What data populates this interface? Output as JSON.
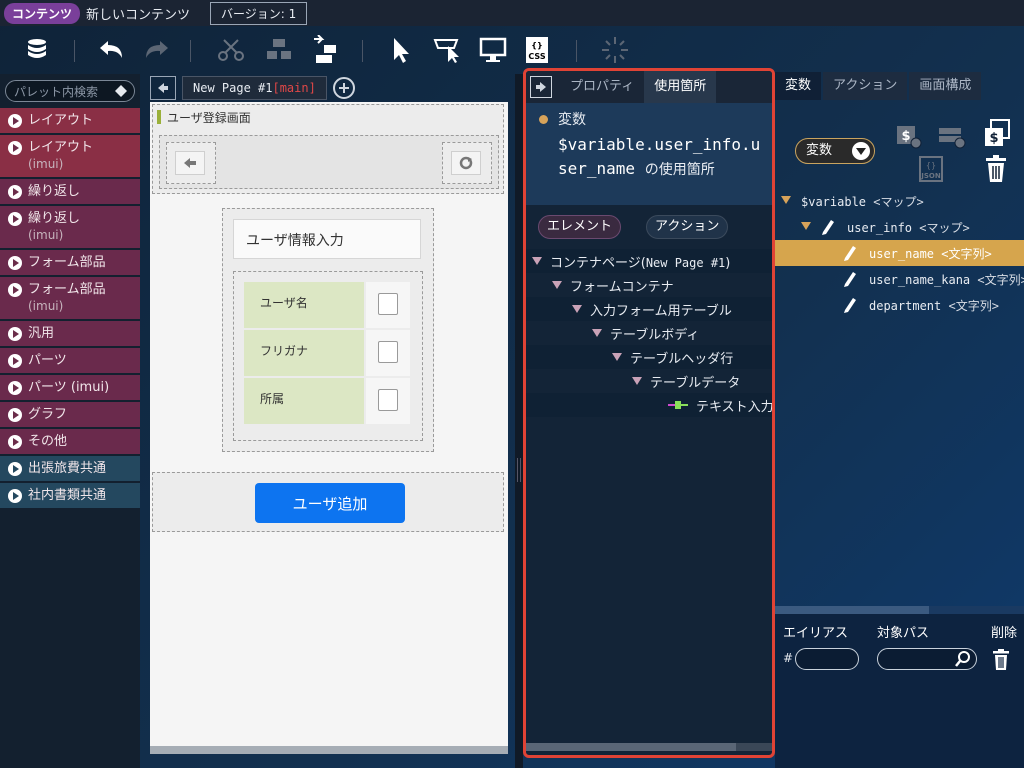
{
  "topbar": {
    "chip": "コンテンツ",
    "title": "新しいコンテンツ",
    "version": "バージョン: 1"
  },
  "toolbar": {
    "icons": [
      "database-icon",
      "undo-icon",
      "redo-icon",
      "cut-icon",
      "component-icon",
      "transform-icon",
      "pointer-icon",
      "select-area-icon",
      "preview-icon",
      "css-icon",
      "spinner-icon"
    ]
  },
  "palette": {
    "search_placeholder": "パレット内検索",
    "items": [
      {
        "label": "レイアウト",
        "sub": ""
      },
      {
        "label": "レイアウト",
        "sub": "(imui)"
      },
      {
        "label": "繰り返し",
        "sub": ""
      },
      {
        "label": "繰り返し",
        "sub": "(imui)"
      },
      {
        "label": "フォーム部品",
        "sub": ""
      },
      {
        "label": "フォーム部品",
        "sub": "(imui)"
      },
      {
        "label": "汎用",
        "sub": ""
      },
      {
        "label": "パーツ",
        "sub": ""
      },
      {
        "label": "パーツ (imui)",
        "sub": ""
      },
      {
        "label": "グラフ",
        "sub": ""
      },
      {
        "label": "その他",
        "sub": ""
      },
      {
        "label": "出張旅費共通",
        "sub": ""
      },
      {
        "label": "社内書類共通",
        "sub": ""
      }
    ]
  },
  "canvas": {
    "tab_label": "New Page #1",
    "tab_suffix": "[main]",
    "header_title": "ユーザ登録画面",
    "form_title": "ユーザ情報入力",
    "rows": [
      "ユーザ名",
      "フリガナ",
      "所属"
    ],
    "button_label": "ユーザ追加"
  },
  "mid": {
    "tabs": [
      "プロパティ",
      "使用箇所"
    ],
    "var_label": "変数",
    "var_expr": "$variable.user_info.user_name",
    "var_suffix": "の使用箇所",
    "pills": [
      "エレメント",
      "アクション"
    ],
    "tree": [
      {
        "label": "コンテナページ(",
        "mono": "New Page #1",
        "tail": ")"
      },
      {
        "label": "フォームコンテナ"
      },
      {
        "label": "入力フォーム用テーブル"
      },
      {
        "label": "テーブルボディ"
      },
      {
        "label": "テーブルヘッダ行"
      },
      {
        "label": "テーブルデータ"
      },
      {
        "label": "テキスト入力"
      }
    ]
  },
  "right": {
    "tabs": [
      "変数",
      "アクション",
      "画面構成"
    ],
    "select_label": "変数",
    "vars": [
      {
        "name": "$variable",
        "type": "<マップ>"
      },
      {
        "name": "user_info",
        "type": "<マップ>"
      },
      {
        "name": "user_name",
        "type": "<文字列>"
      },
      {
        "name": "user_name_kana",
        "type": "<文字列>"
      },
      {
        "name": "department",
        "type": "<文字列>"
      }
    ],
    "alias": {
      "col_alias": "エイリアス",
      "col_path": "対象パス",
      "col_delete": "削除",
      "hash": "#"
    }
  },
  "colors": {
    "accent": "#0d74f0",
    "highlight": "#d6a54d",
    "panel_border": "#e04335"
  }
}
